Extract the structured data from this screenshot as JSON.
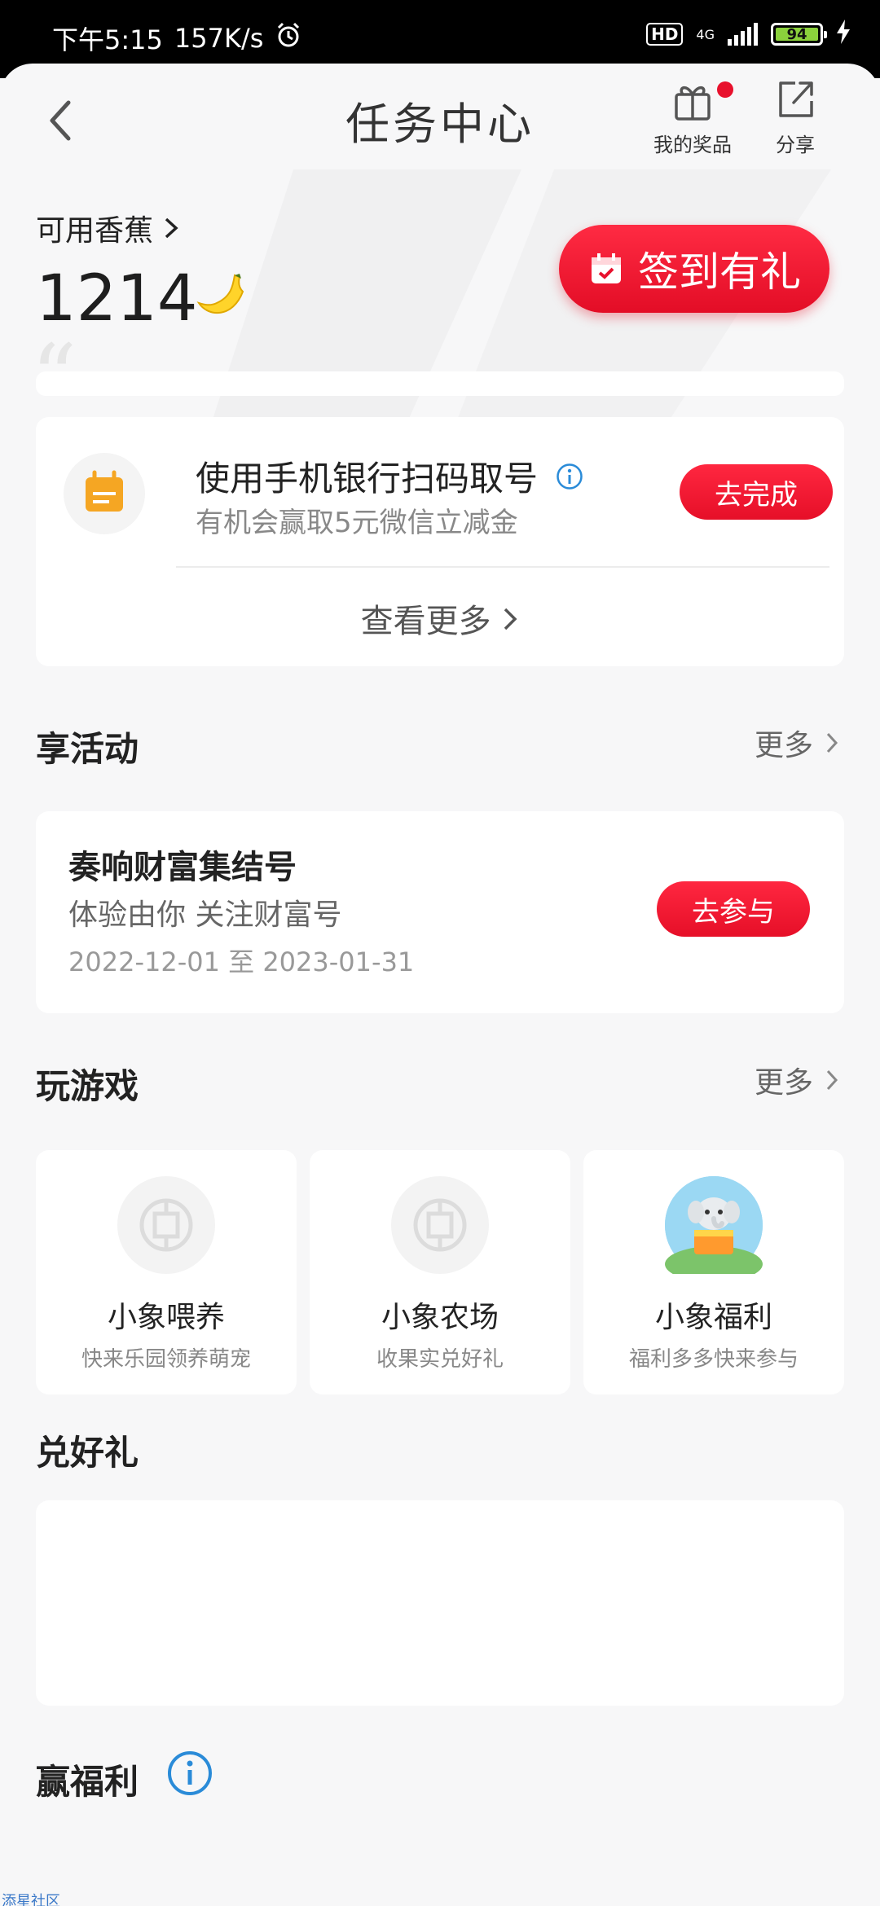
{
  "status_bar": {
    "time": "下午5:15",
    "speed": "157K/s",
    "hd": "HD",
    "network": "4G",
    "battery": "94"
  },
  "header": {
    "title": "任务中心",
    "prizes_label": "我的奖品",
    "share_label": "分享"
  },
  "points": {
    "label": "可用香蕉",
    "value": "1214",
    "signin_label": "签到有礼"
  },
  "task": {
    "title": "使用手机银行扫码取号",
    "subtitle": "有机会赢取5元微信立减金",
    "button": "去完成",
    "more": "查看更多"
  },
  "activities": {
    "section_title": "享活动",
    "more": "更多",
    "item": {
      "title": "奏响财富集结号",
      "subtitle": "体验由你 关注财富号",
      "date": "2022-12-01 至 2023-01-31",
      "button": "去参与"
    }
  },
  "games": {
    "section_title": "玩游戏",
    "more": "更多",
    "items": [
      {
        "title": "小象喂养",
        "subtitle": "快来乐园领养萌宠"
      },
      {
        "title": "小象农场",
        "subtitle": "收果实兑好礼"
      },
      {
        "title": "小象福利",
        "subtitle": "福利多多快来参与"
      }
    ]
  },
  "gifts": {
    "section_title": "兑好礼"
  },
  "welfare": {
    "section_title": "赢福利"
  },
  "watermark": "添星社区",
  "colors": {
    "accent_red": "#e8112d",
    "task_icon_orange": "#f5a623",
    "info_blue": "#2a8bd8"
  }
}
